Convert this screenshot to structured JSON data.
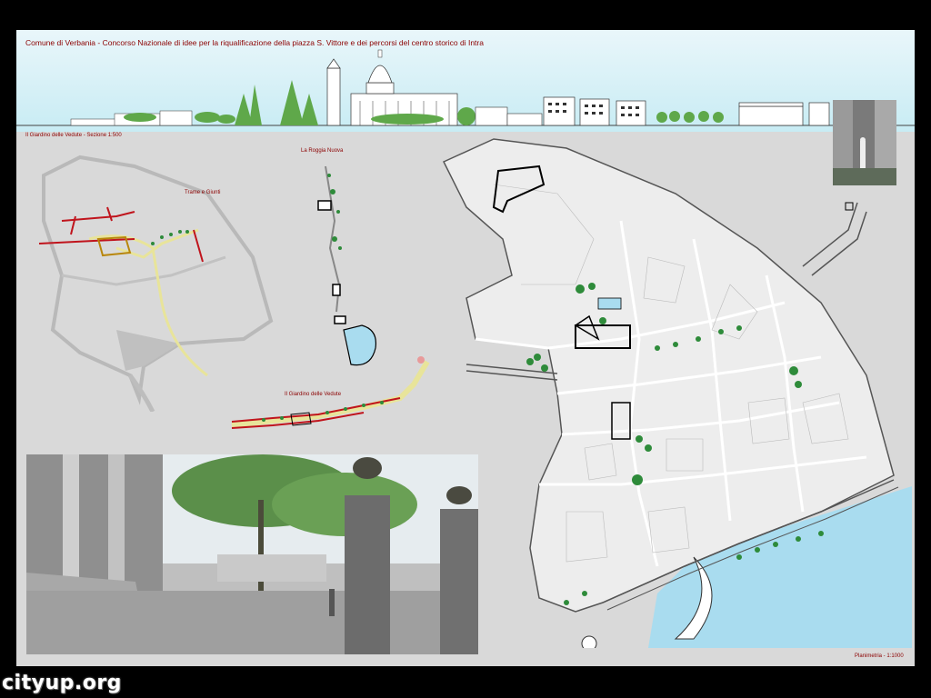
{
  "board": {
    "title": "Comune di Verbania - Concorso Nazionale di idee per la riqualificazione della piazza S. Vittore e dei percorsi del centro storico di Intra"
  },
  "labels": {
    "section": "Il Giardino delle Vedute - Sezione 1:500",
    "trame": "Trame e Giunti",
    "roggia": "La Roggia Nuova",
    "giardino": "Il Giardino delle Vedute",
    "planimetria": "Planimetria - 1:1000"
  },
  "watermark": "cityup.org",
  "colors": {
    "caption": "#8b0000",
    "sky": "#c8ecf4",
    "water": "#a9dcef",
    "path_red": "#c0141c",
    "path_yellow": "#e8e49a",
    "tree": "#2e8b3a"
  }
}
